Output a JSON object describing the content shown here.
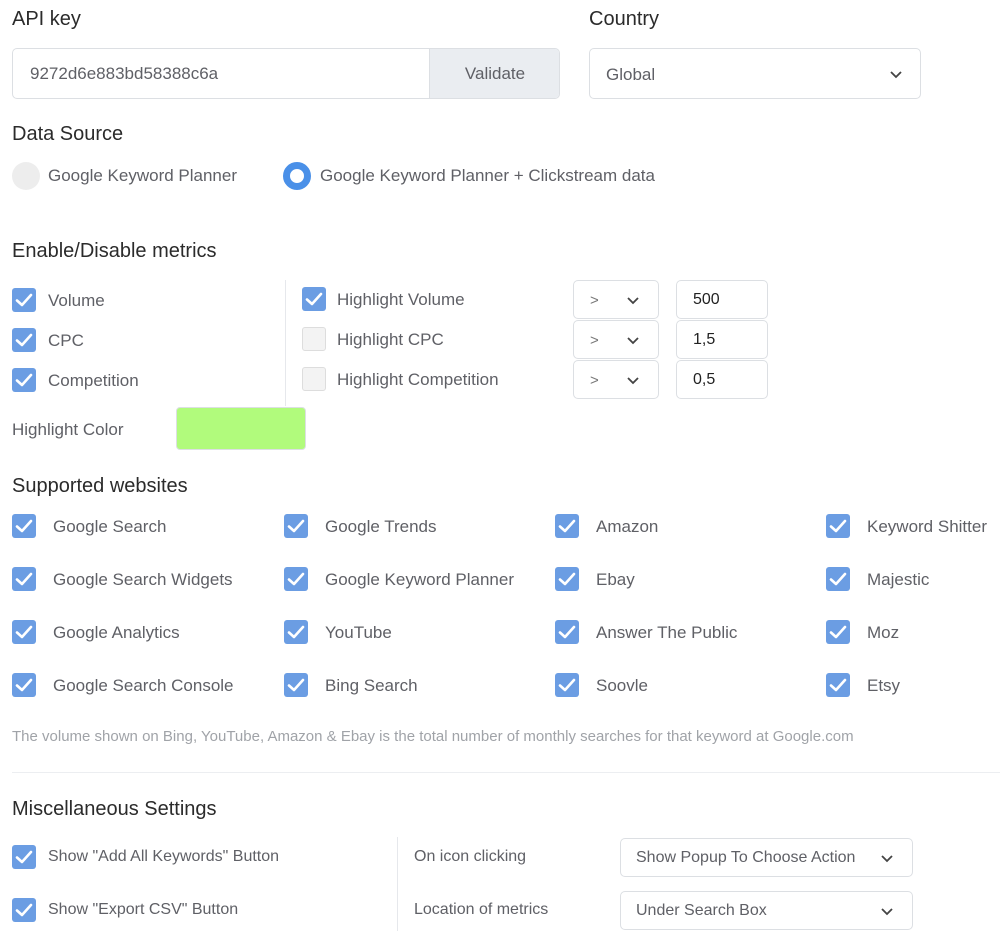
{
  "api_key": {
    "label": "API key",
    "value": "9272d6e883bd58388c6a",
    "validate_label": "Validate"
  },
  "country": {
    "label": "Country",
    "selected": "Global"
  },
  "data_source": {
    "label": "Data Source",
    "options": [
      {
        "label": "Google Keyword Planner",
        "selected": false
      },
      {
        "label": "Google Keyword Planner + Clickstream data",
        "selected": true
      }
    ]
  },
  "metrics": {
    "label": "Enable/Disable metrics",
    "enabled": [
      {
        "label": "Volume",
        "checked": true
      },
      {
        "label": "CPC",
        "checked": true
      },
      {
        "label": "Competition",
        "checked": true
      }
    ],
    "highlight_color_label": "Highlight Color",
    "highlight_color": "#b1fb7c",
    "highlights": [
      {
        "label": "Highlight Volume",
        "checked": true,
        "operator": ">",
        "value": "500"
      },
      {
        "label": "Highlight CPC",
        "checked": false,
        "operator": ">",
        "value": "1,5"
      },
      {
        "label": "Highlight Competition",
        "checked": false,
        "operator": ">",
        "value": "0,5"
      }
    ]
  },
  "websites": {
    "label": "Supported websites",
    "columns": [
      [
        {
          "label": "Google Search",
          "checked": true
        },
        {
          "label": "Google Search Widgets",
          "checked": true
        },
        {
          "label": "Google Analytics",
          "checked": true
        },
        {
          "label": "Google Search Console",
          "checked": true
        }
      ],
      [
        {
          "label": "Google Trends",
          "checked": true
        },
        {
          "label": "Google Keyword Planner",
          "checked": true
        },
        {
          "label": "YouTube",
          "checked": true
        },
        {
          "label": "Bing Search",
          "checked": true
        }
      ],
      [
        {
          "label": "Amazon",
          "checked": true
        },
        {
          "label": "Ebay",
          "checked": true
        },
        {
          "label": "Answer The Public",
          "checked": true
        },
        {
          "label": "Soovle",
          "checked": true
        }
      ],
      [
        {
          "label": "Keyword Shitter",
          "checked": true
        },
        {
          "label": "Majestic",
          "checked": true
        },
        {
          "label": "Moz",
          "checked": true
        },
        {
          "label": "Etsy",
          "checked": true
        }
      ]
    ],
    "note": "The volume shown on Bing, YouTube, Amazon & Ebay is the total number of monthly searches for that keyword at Google.com"
  },
  "misc": {
    "label": "Miscellaneous Settings",
    "toggles": [
      {
        "label": "Show \"Add All Keywords\" Button",
        "checked": true
      },
      {
        "label": "Show \"Export CSV\" Button",
        "checked": true
      }
    ],
    "selects": [
      {
        "label": "On icon clicking",
        "selected": "Show Popup To Choose Action"
      },
      {
        "label": "Location of metrics",
        "selected": "Under Search Box"
      }
    ]
  },
  "colors": {
    "accent": "#6b9de3",
    "radio_selected": "#4a90e8",
    "highlight": "#b1fb7c"
  }
}
